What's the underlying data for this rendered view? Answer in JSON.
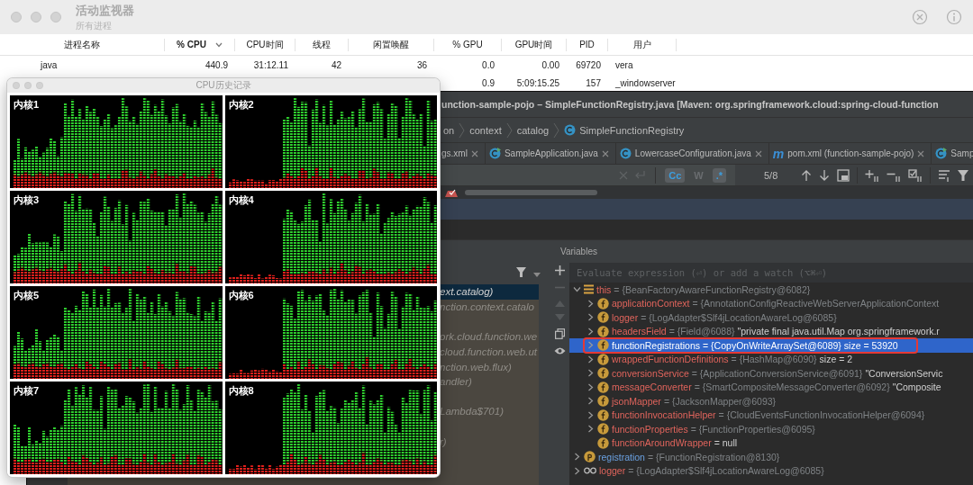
{
  "activity_monitor": {
    "title": "活动监视器",
    "subtitle": "所有进程",
    "columns": [
      {
        "label": "进程名称",
        "sorted": false
      },
      {
        "label": "% CPU",
        "sorted": true
      },
      {
        "label": "CPU时间",
        "sorted": false
      },
      {
        "label": "线程",
        "sorted": false
      },
      {
        "label": "闲置唤醒",
        "sorted": false
      },
      {
        "label": "% GPU",
        "sorted": false
      },
      {
        "label": "GPU时间",
        "sorted": false
      },
      {
        "label": "PID",
        "sorted": false
      },
      {
        "label": "用户",
        "sorted": false
      }
    ],
    "rows": [
      {
        "cells": [
          "java",
          "440.9",
          "31:12.11",
          "42",
          "36",
          "0.0",
          "0.00",
          "69720",
          "vera"
        ]
      },
      {
        "cells": [
          "",
          "",
          "",
          "",
          "",
          "0.9",
          "5:09:15.25",
          "157",
          "_windowserver"
        ]
      }
    ]
  },
  "cpu_history": {
    "title": "CPU历史记录",
    "cores": [
      {
        "label": "内核1"
      },
      {
        "label": "内核2"
      },
      {
        "label": "内核3"
      },
      {
        "label": "内核4"
      },
      {
        "label": "内核5"
      },
      {
        "label": "内核6"
      },
      {
        "label": "内核7"
      },
      {
        "label": "内核8"
      }
    ]
  },
  "ide": {
    "title": "unction-sample-pojo – SimpleFunctionRegistry.java [Maven: org.springframework.cloud:spring-cloud-function",
    "breadcrumbs": [
      {
        "label": "on",
        "kind": "package"
      },
      {
        "label": "context",
        "kind": "package"
      },
      {
        "label": "catalog",
        "kind": "package"
      },
      {
        "label": "SimpleFunctionRegistry",
        "kind": "class"
      }
    ],
    "tabs": [
      {
        "label": "gs.xml",
        "kind": "xml",
        "closable": true
      },
      {
        "label": "SampleApplication.java",
        "kind": "runnable-class",
        "closable": true
      },
      {
        "label": "LowercaseConfiguration.java",
        "kind": "class",
        "closable": true
      },
      {
        "label": "pom.xml (function-sample-pojo)",
        "kind": "maven",
        "icon_text": "m",
        "closable": true
      },
      {
        "label": "Samp",
        "kind": "runnable-class",
        "closable": false
      }
    ],
    "find_bar": {
      "toggles": [
        {
          "label": "Cc",
          "selected": true
        },
        {
          "label": "W",
          "selected": false
        },
        {
          "label": ".*",
          "selected": true
        }
      ],
      "match_count": "5/8"
    },
    "frames": [
      {
        "kind": "fragment",
        "text": "ext.catalog)",
        "selected": true
      },
      {
        "kind": "fragment",
        "text": "nction.context.catalo",
        "selected": false
      },
      {
        "kind": "covered",
        "selected": false
      },
      {
        "kind": "fragment",
        "text": "ork.cloud.function.we",
        "selected": false
      },
      {
        "kind": "fragment",
        "text": "cloud.function.web.ut",
        "selected": false
      },
      {
        "kind": "fragment",
        "text": "nction.web.flux)",
        "selected": false
      },
      {
        "kind": "fragment",
        "text": "andler)",
        "selected": false
      },
      {
        "kind": "covered",
        "selected": false
      },
      {
        "kind": "fragment",
        "text": "Lambda$701)",
        "selected": false
      },
      {
        "kind": "covered",
        "selected": false
      },
      {
        "kind": "fragment",
        "text": "r)",
        "selected": false
      }
    ],
    "variables": {
      "title": "Variables",
      "placeholder": "Evaluate expression (⏎) or add a watch (⌥⌘⏎)",
      "items": [
        {
          "kind": "object",
          "name": "this",
          "value": "= {BeanFactoryAwareFunctionRegistry@6082}",
          "leaf": false,
          "expanded": true,
          "selected": false,
          "annotated": false,
          "children": [
            {
              "kind": "field",
              "name": "applicationContext",
              "value": "= {AnnotationConfigReactiveWebServerApplicationContext",
              "leaf": false,
              "expanded": false,
              "selected": false,
              "annotated": false
            },
            {
              "kind": "field",
              "name": "logger",
              "value": "= {LogAdapter$Slf4jLocationAwareLog@6085}",
              "leaf": false,
              "expanded": false,
              "selected": false,
              "annotated": false
            },
            {
              "kind": "field",
              "name": "headersField",
              "value": "= {Field@6088}",
              "detail": "\"private final java.util.Map org.springframework.r",
              "leaf": false,
              "expanded": false,
              "selected": false,
              "annotated": false
            },
            {
              "kind": "field",
              "name": "functionRegistrations",
              "value": "= {CopyOnWriteArraySet@6089}",
              "detail": "size = 53920",
              "leaf": false,
              "expanded": false,
              "selected": true,
              "annotated": true
            },
            {
              "kind": "field",
              "name": "wrappedFunctionDefinitions",
              "value": "= {HashMap@6090}",
              "detail": "size = 2",
              "leaf": false,
              "expanded": false,
              "selected": false,
              "annotated": false
            },
            {
              "kind": "field",
              "name": "conversionService",
              "value": "= {ApplicationConversionService@6091}",
              "detail": "\"ConversionServic",
              "leaf": false,
              "expanded": false,
              "selected": false,
              "annotated": false
            },
            {
              "kind": "field",
              "name": "messageConverter",
              "value": "= {SmartCompositeMessageConverter@6092}",
              "detail": "\"Composite",
              "leaf": false,
              "expanded": false,
              "selected": false,
              "annotated": false
            },
            {
              "kind": "field",
              "name": "jsonMapper",
              "value": "= {JacksonMapper@6093}",
              "leaf": false,
              "expanded": false,
              "selected": false,
              "annotated": false
            },
            {
              "kind": "field",
              "name": "functionInvocationHelper",
              "value": "= {CloudEventsFunctionInvocationHelper@6094}",
              "leaf": false,
              "expanded": false,
              "selected": false,
              "annotated": false
            },
            {
              "kind": "field",
              "name": "functionProperties",
              "value": "= {FunctionProperties@6095}",
              "leaf": false,
              "expanded": false,
              "selected": false,
              "annotated": false
            },
            {
              "kind": "field",
              "name": "functionAroundWrapper",
              "detail": "= null",
              "leaf": true,
              "expanded": false,
              "selected": false,
              "annotated": false
            }
          ]
        },
        {
          "kind": "parameter",
          "name": "registration",
          "value": "= {FunctionRegistration@8130}",
          "leaf": false,
          "expanded": false,
          "selected": false,
          "annotated": false
        },
        {
          "kind": "static",
          "name": "logger",
          "value": "= {LogAdapter$Slf4jLocationAwareLog@6085}",
          "leaf": false,
          "expanded": false,
          "selected": false,
          "annotated": false
        }
      ]
    }
  }
}
